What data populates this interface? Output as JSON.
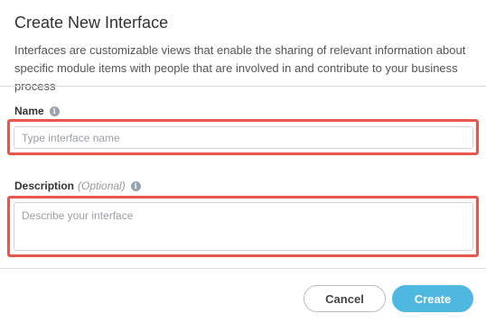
{
  "dialog": {
    "title": "Create New Interface",
    "subtitle": "Interfaces are customizable views that enable the sharing of relevant information about specific module items with people that are involved in and contribute to your business process"
  },
  "form": {
    "name": {
      "label": "Name",
      "info_icon": "info-icon",
      "placeholder": "Type interface name",
      "value": ""
    },
    "description": {
      "label": "Description",
      "optional": "(Optional)",
      "info_icon": "info-icon",
      "placeholder": "Describe your interface",
      "value": ""
    }
  },
  "actions": {
    "cancel_label": "Cancel",
    "create_label": "Create"
  },
  "colors": {
    "accent": "#4fb8e0",
    "highlight": "#e8574c"
  }
}
